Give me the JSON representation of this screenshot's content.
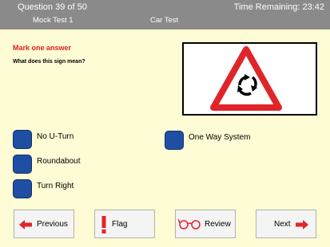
{
  "header": {
    "question_count": "Question 39 of 50",
    "time_remaining": "Time Remaining:  23:42",
    "test_name": "Mock Test 1",
    "test_type": "Car Test"
  },
  "question": {
    "prompt": "Mark one answer",
    "text": "What does this sign mean?"
  },
  "answers": {
    "a1": "No U-Turn",
    "a2": "Roundabout",
    "a3": "Turn Right",
    "a4": "One Way System"
  },
  "nav": {
    "previous": "Previous",
    "flag": "Flag",
    "review": "Review",
    "next": "Next"
  },
  "colors": {
    "background": "#fdfcd4",
    "header": "#8a8a8a",
    "answer_button": "#1f4fa3",
    "prompt_text": "#e02020",
    "arrow": "#e0252a"
  }
}
